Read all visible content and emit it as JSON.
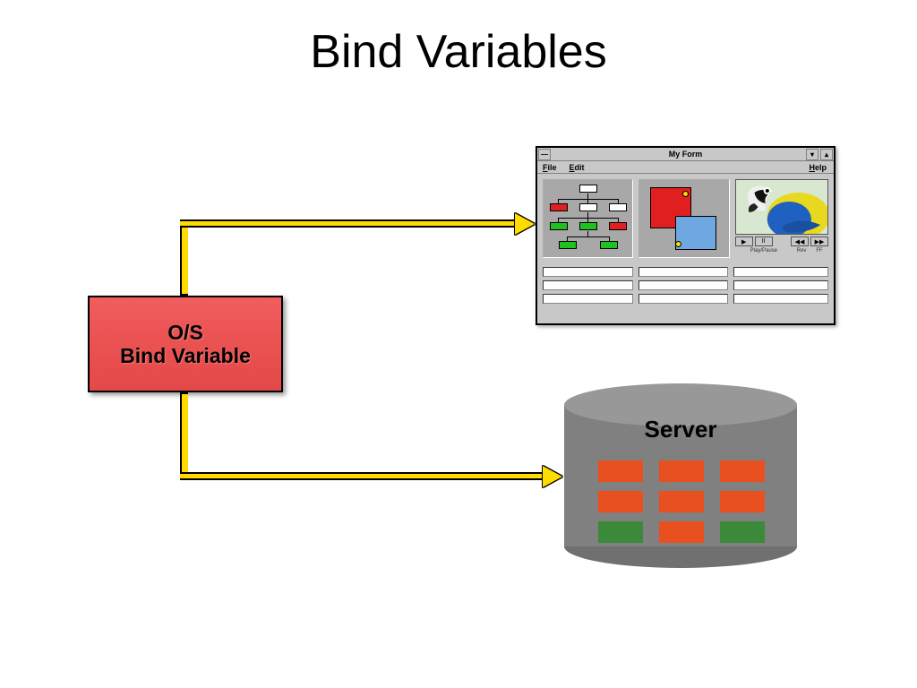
{
  "title": "Bind Variables",
  "os_box": {
    "line1": "O/S",
    "line2": "Bind Variable"
  },
  "form_window": {
    "title": "My Form",
    "menu": {
      "file": "File",
      "edit": "Edit",
      "help": "Help"
    },
    "media": {
      "playpause": "Play/Pause",
      "rev": "Rev",
      "ff": "FF",
      "play_glyph": "▶",
      "pause_glyph": "II",
      "rev_glyph": "◀◀",
      "ff_glyph": "▶▶"
    },
    "sysmenu_glyph": "—",
    "min_glyph": "▾",
    "max_glyph": "▴"
  },
  "server": {
    "label": "Server"
  }
}
